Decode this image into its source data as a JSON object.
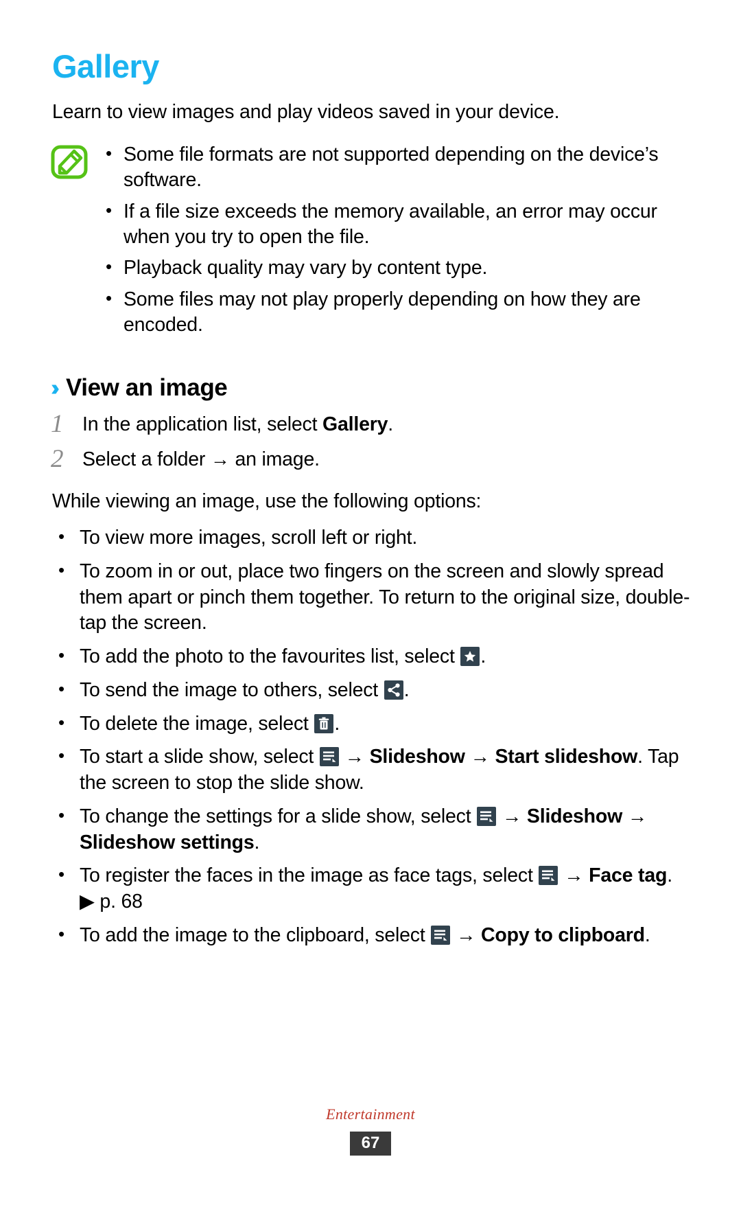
{
  "page": {
    "title": "Gallery",
    "title_color": "#1BB3F0",
    "intro": "Learn to view images and play videos saved in your device."
  },
  "note": {
    "icon": "note-pencil-icon",
    "icon_color": "#55C216",
    "bullets": [
      "Some file formats are not supported depending on the device’s software.",
      "If a file size exceeds the memory available, an error may occur when you try to open the file.",
      "Playback quality may vary by content type.",
      "Some files may not play properly depending on how they are encoded."
    ]
  },
  "section": {
    "chevron": "››",
    "title": "View an image",
    "steps": [
      {
        "num": "1",
        "text_before": "In the application list, select ",
        "bold": "Gallery",
        "text_after": "."
      },
      {
        "num": "2",
        "text_before": "Select a folder ",
        "arrow": "→",
        "text_after": " an image."
      }
    ],
    "lead_in": "While viewing an image, use the following options:",
    "options": [
      {
        "id": "scroll-option",
        "parts": [
          {
            "t": "To view more images, scroll left or right."
          }
        ]
      },
      {
        "id": "zoom-option",
        "parts": [
          {
            "t": "To zoom in or out, place two fingers on the screen and slowly spread them apart or pinch them together. To return to the original size, double-tap the screen."
          }
        ]
      },
      {
        "id": "favourites-option",
        "parts": [
          {
            "t": "To add the photo to the favourites list, select "
          },
          {
            "icon": "star-icon"
          },
          {
            "t": "."
          }
        ]
      },
      {
        "id": "share-option",
        "parts": [
          {
            "t": "To send the image to others, select "
          },
          {
            "icon": "share-icon"
          },
          {
            "t": "."
          }
        ]
      },
      {
        "id": "delete-option",
        "parts": [
          {
            "t": "To delete the image, select "
          },
          {
            "icon": "trash-icon"
          },
          {
            "t": "."
          }
        ]
      },
      {
        "id": "slideshow-start-option",
        "parts": [
          {
            "t": "To start a slide show, select "
          },
          {
            "icon": "options-menu-icon"
          },
          {
            "t": " → "
          },
          {
            "b": "Slideshow"
          },
          {
            "t": " → "
          },
          {
            "b": "Start slideshow"
          },
          {
            "t": ". Tap the screen to stop the slide show."
          }
        ]
      },
      {
        "id": "slideshow-settings-option",
        "parts": [
          {
            "t": "To change the settings for a slide show, select "
          },
          {
            "icon": "options-menu-icon"
          },
          {
            "t": " → "
          },
          {
            "b": "Slideshow"
          },
          {
            "t": " → "
          },
          {
            "b": "Slideshow settings"
          },
          {
            "t": "."
          }
        ]
      },
      {
        "id": "face-tag-option",
        "parts": [
          {
            "t": "To register the faces in the image as face tags, select "
          },
          {
            "icon": "options-menu-icon"
          },
          {
            "t": " → "
          },
          {
            "b": "Face tag"
          },
          {
            "t": ". "
          },
          {
            "t": "▶ p. 68"
          }
        ]
      },
      {
        "id": "clipboard-option",
        "parts": [
          {
            "t": "To add the image to the clipboard, select "
          },
          {
            "icon": "options-menu-icon"
          },
          {
            "t": " → "
          },
          {
            "b": "Copy to clipboard"
          },
          {
            "t": "."
          }
        ]
      }
    ]
  },
  "footer": {
    "label": "Entertainment",
    "page_number": "67"
  }
}
